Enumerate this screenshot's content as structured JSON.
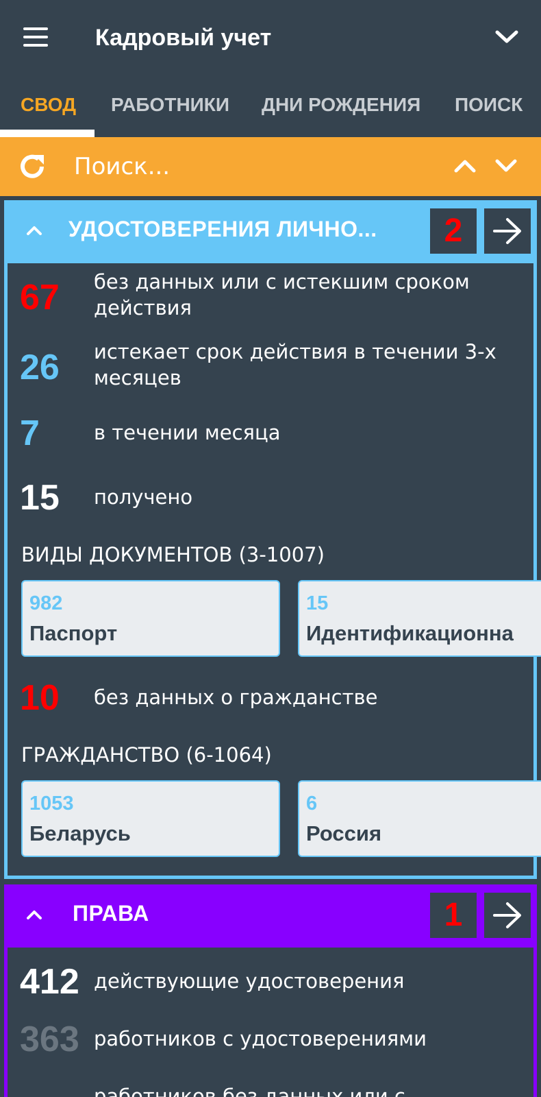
{
  "app": {
    "title": "Кадровый учет"
  },
  "tabs": [
    {
      "label": "СВОД"
    },
    {
      "label": "РАБОТНИКИ"
    },
    {
      "label": "ДНИ РОЖДЕНИЯ"
    },
    {
      "label": "ПОИСК"
    }
  ],
  "search": {
    "placeholder": "Поиск..."
  },
  "colors": {
    "primary": "#35434f",
    "accent": "#f8a833",
    "id_card": "#66c6f7",
    "prava_card": "#8800ff",
    "alert": "#ff0000"
  },
  "id_card": {
    "title": "УДОСТОВЕРЕНИЯ ЛИЧНО...",
    "badge": "2",
    "stats": [
      {
        "value": "67",
        "text": "без данных или с истекшим сроком действия",
        "color": "#ff0000"
      },
      {
        "value": "26",
        "text": "истекает срок действия в течении 3-х месяцев",
        "color": "#66c6f7"
      },
      {
        "value": "7",
        "text": "в течении месяца",
        "color": "#66c6f7"
      },
      {
        "value": "15",
        "text": "получено",
        "color": "#ffffff"
      }
    ],
    "doc_types_title": "ВИДЫ ДОКУМЕНТОВ (3-1007)",
    "doc_types": [
      {
        "value": "982",
        "label": "Паспорт"
      },
      {
        "value": "15",
        "label": "Идентификационна"
      }
    ],
    "citizenship_stat": {
      "value": "10",
      "text": "без данных о гражданстве",
      "color": "#ff0000"
    },
    "citizenship_title": "ГРАЖДАНСТВО (6-1064)",
    "citizenship": [
      {
        "value": "1053",
        "label": "Беларусь"
      },
      {
        "value": "6",
        "label": "Россия"
      }
    ]
  },
  "prava_card": {
    "title": "ПРАВА",
    "badge": "1",
    "stats": [
      {
        "value": "412",
        "text": "действующие удостоверения",
        "color": "#ffffff"
      },
      {
        "value": "363",
        "text": "работников с удостоверениями",
        "color": "#6b7680"
      },
      {
        "value": "",
        "text": "работников без данных или с",
        "color": "#ffffff"
      }
    ]
  }
}
